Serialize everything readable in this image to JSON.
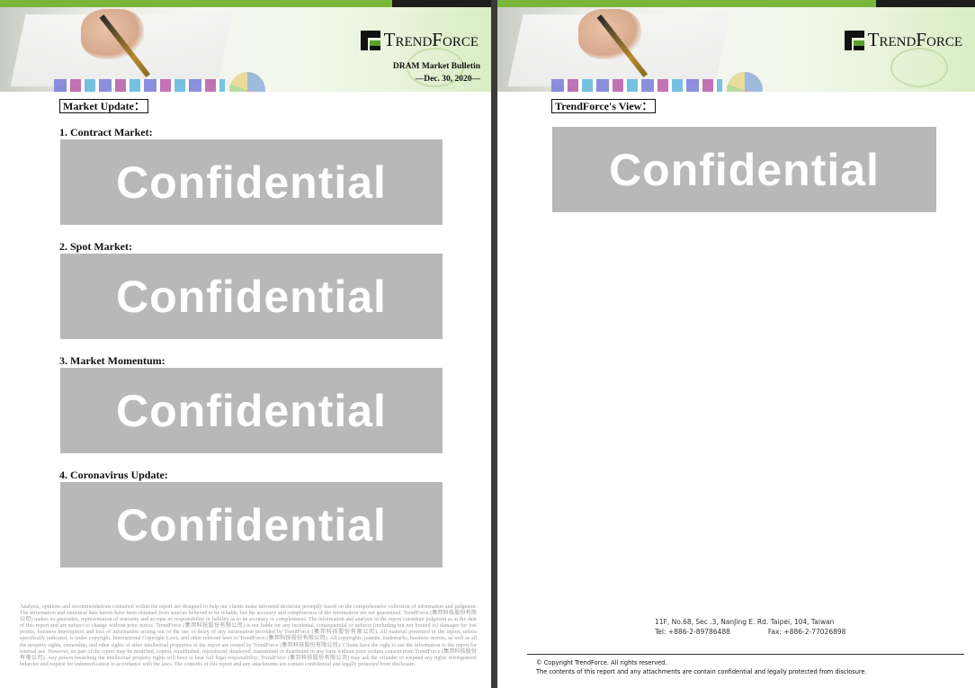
{
  "brand": {
    "logo_text": "TrendForce",
    "green": "#7ab63a",
    "dark": "#1e1e1e"
  },
  "page1": {
    "bulletin_title": "DRAM Market Bulletin",
    "bulletin_date": "—Dec. 30, 2020—",
    "section_title": "Market Update：",
    "sections": [
      {
        "heading": "1.   Contract Market:",
        "placeholder": "Confidential"
      },
      {
        "heading": "2.   Spot Market:",
        "placeholder": "Confidential"
      },
      {
        "heading": "3.   Market Momentum:",
        "placeholder": "Confidential"
      },
      {
        "heading": "4.   Coronavirus Update:",
        "placeholder": "Confidential"
      }
    ],
    "disclaimer": "Analysis, opinions and recommendations contained within the report are designed to help our clients make informed decisions promptly based on the comprehensive collection of information and judgment. The information and statistical data herein have been obtained from sources believed to be reliable, but the accuracy and completeness of the information are not guaranteed. TrendForce (集邦科技股份有限公司) makes no guarantee, representation of warranty and accepts no responsibility or liability as to its accuracy or completeness. The information and analysis in the report constitute judgment as at the date of this report and are subject to change without prior notice. TrendForce (集邦科技股份有限公司) is not liable for any incidental, consequential or indirect (including but not limited to) damages for lost profits, business interruption and loss of information arising out of the use of delay of any information provided by TrendForce (集邦科技股份有限公司). All material presented in the report, unless specifically indicated, is under copyright. International Copyright Laws, and other relevant laws to TrendForce (集邦科技股份有限公司). All copyrights, patents, trademarks, business secrets, as well as all the property rights, ownership, and other rights of other intellectual properties in the report are owned by TrendForce (集邦科技股份有限公司). Clients have the right to use the information in the report for internal use. However, no part of the report may be modified, copied, republished, reproduced, displayed, transmitted or distributed in any form without prior written consent from TrendForce (集邦科技股份有限公司). Any person breaching the intellectual property rights will have to bear full legal responsibility; TrendForce (集邦科技股份有限公司) may ask the offender to suspend any rights infringement behavior and request for indemnification in accordance with the laws. The contents of this report and any attachments are contain confidential and legally protected from disclosure."
  },
  "page2": {
    "section_title": "TrendForce's View：",
    "placeholder": "Confidential",
    "address_line": "11F, No.68, Sec .3, NanJing E. Rd. Taipei, 104, Taiwan",
    "tel": "Tel: +886-2-89786488",
    "fax": "Fax: +886-2-77026898",
    "copyright": "© Copyright TrendForce. All rights reserved.",
    "confidential_notice": "The contents of this report and any attachments are contain confidential and legally protected from disclosure."
  }
}
